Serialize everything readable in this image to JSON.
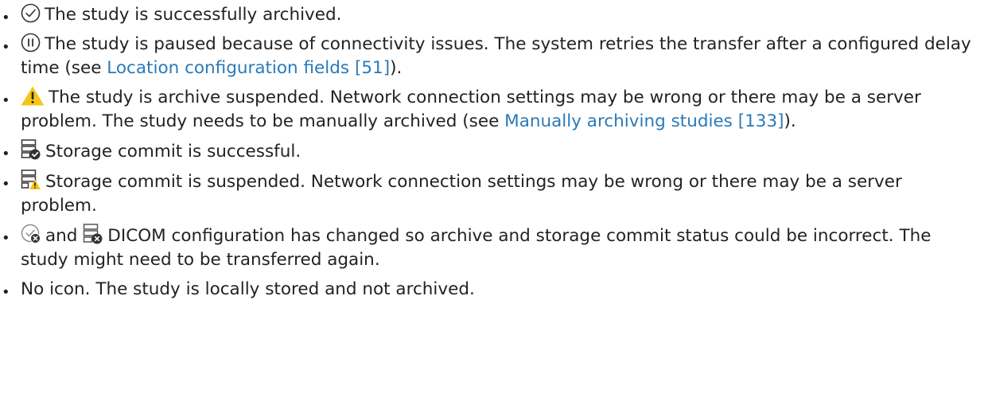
{
  "bullet": "•",
  "items": [
    {
      "icon": "archived-check-icon",
      "text": "The study is successfully archived."
    },
    {
      "icon": "paused-icon",
      "text": "The study is paused because of connectivity issues. The system retries the transfer after a configured delay time (see ",
      "link": "Location configuration fields [51]",
      "after": ")."
    },
    {
      "icon": "warning-icon",
      "text": "The study is archive suspended. Network connection settings may be wrong or there may be a server problem. The study needs to be manually archived (see ",
      "link": "Manually archiving studies [133]",
      "after": ")."
    },
    {
      "icon": "storage-commit-success-icon",
      "text": "Storage commit is successful."
    },
    {
      "icon": "storage-commit-warning-icon",
      "text": "Storage commit is suspended. Network connection settings may be wrong or there may be a server problem."
    },
    {
      "icon": "archive-config-changed-icon",
      "conjunction": "and",
      "icon2": "storage-config-changed-icon",
      "text": "DICOM configuration has changed so archive and storage commit status could be incorrect. The study might need to be transferred again."
    },
    {
      "text": "No icon. The study is locally stored and not archived."
    }
  ],
  "colors": {
    "text": "#222222",
    "link": "#2a7ab8",
    "warning": "#f5c518",
    "icon": "#333333"
  }
}
